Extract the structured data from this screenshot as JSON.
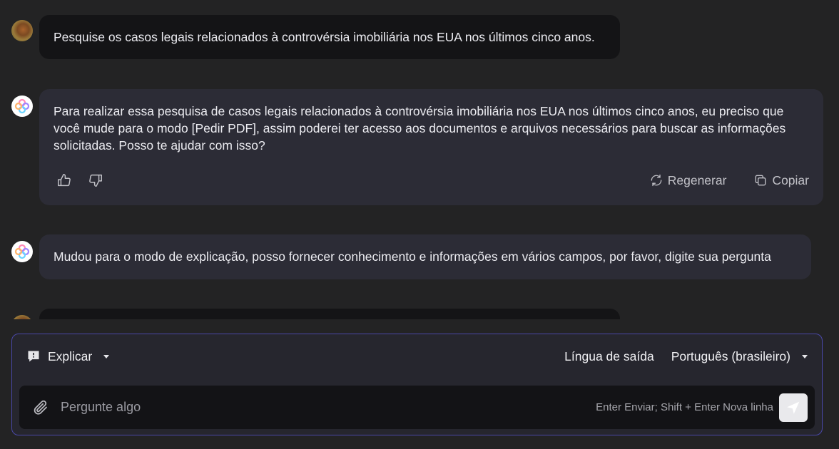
{
  "messages": {
    "user1": {
      "text": "Pesquise os casos legais relacionados à controvérsia imobiliária nos EUA nos últimos cinco anos."
    },
    "bot1": {
      "text": "Para realizar essa pesquisa de casos legais relacionados à controvérsia imobiliária nos EUA nos últimos cinco anos, eu preciso que você mude para o modo [Pedir PDF], assim poderei ter acesso aos documentos e arquivos necessários para buscar as informações solicitadas. Posso te ajudar com isso?",
      "regenerate_label": "Regenerar",
      "copy_label": "Copiar"
    },
    "bot2": {
      "text": "Mudou para o modo de explicação, posso fornecer conhecimento e informações em vários campos, por favor, digite sua pergunta"
    }
  },
  "composer": {
    "mode_label": "Explicar",
    "output_language_label": "Língua de saída",
    "output_language_value": "Português (brasileiro)",
    "input_placeholder": "Pergunte algo",
    "input_value": "",
    "hint": "Enter Enviar; Shift + Enter Nova linha"
  },
  "colors": {
    "background": "#232324",
    "user_bubble": "#141416",
    "bot_bubble": "#2c2c36",
    "composer_border": "#4a48a8"
  },
  "icons": [
    "bot-logo-icon",
    "thumbs-up-icon",
    "thumbs-down-icon",
    "regenerate-icon",
    "copy-icon",
    "explain-mode-icon",
    "attach-icon",
    "send-icon"
  ]
}
